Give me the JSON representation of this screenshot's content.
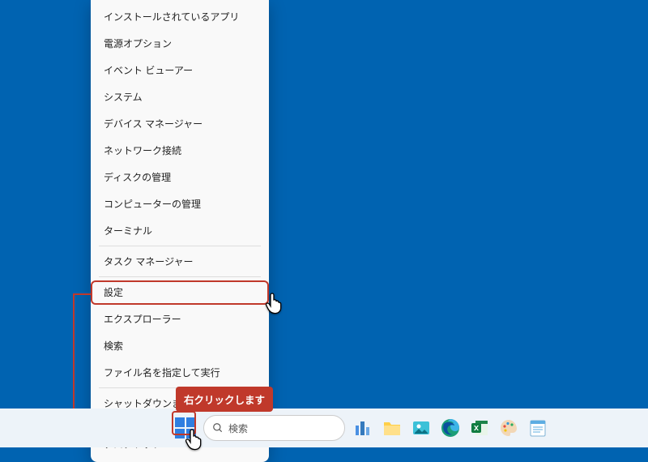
{
  "context_menu": {
    "items": [
      {
        "label": "インストールされているアプリ"
      },
      {
        "label": "電源オプション"
      },
      {
        "label": "イベント ビューアー"
      },
      {
        "label": "システム"
      },
      {
        "label": "デバイス マネージャー"
      },
      {
        "label": "ネットワーク接続"
      },
      {
        "label": "ディスクの管理"
      },
      {
        "label": "コンピューターの管理"
      },
      {
        "label": "ターミナル"
      },
      {
        "sep": true
      },
      {
        "label": "タスク マネージャー"
      },
      {
        "sep": true
      },
      {
        "label": "設定"
      },
      {
        "label": "エクスプローラー",
        "highlighted": true
      },
      {
        "label": "検索"
      },
      {
        "label": "ファイル名を指定して実行"
      },
      {
        "sep": true
      },
      {
        "label": "シャットダウンまたはサインアウト",
        "submenu": true
      },
      {
        "label": "デスクトップ"
      }
    ]
  },
  "callout": {
    "text": "右クリックします"
  },
  "search": {
    "placeholder": "検索"
  },
  "taskbar": {
    "icons": [
      "start",
      "search",
      "buildings",
      "explorer",
      "photos",
      "edge",
      "excel",
      "paint",
      "notepad"
    ]
  },
  "colors": {
    "desktop": "#0063B1",
    "highlight": "#C0392B",
    "taskbar": "#edf3f9"
  }
}
